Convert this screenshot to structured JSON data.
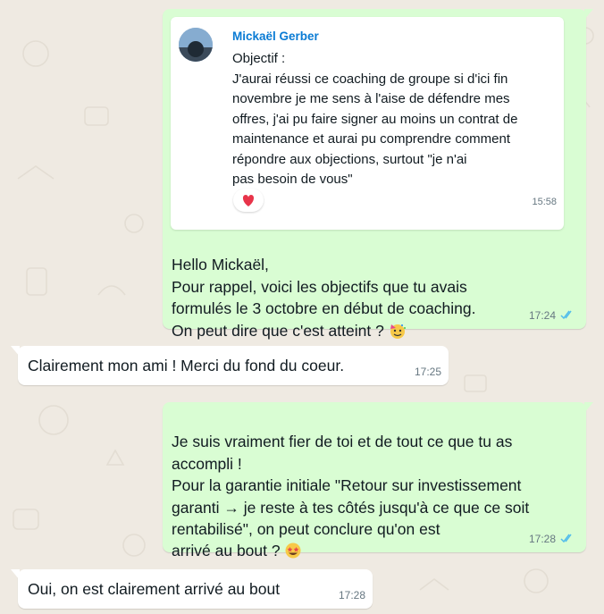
{
  "colors": {
    "background": "#efeae2",
    "outgoing_bubble": "#d9fdd3",
    "incoming_bubble": "#ffffff",
    "quoted_author": "#0a7bd4",
    "read_ticks": "#53bdeb",
    "heart": "#e8344a"
  },
  "messages": [
    {
      "direction": "outgoing",
      "quoted": {
        "author": "Mickaël Gerber",
        "text": "Objectif :\nJ'aurai réussi ce coaching de groupe si d'ici fin\nnovembre je me sens à l'aise de défendre mes\noffres, j'ai pu faire signer au moins un contrat de\nmaintenance et aurai pu comprendre comment\nrépondre aux objections, surtout \"je n'ai\npas besoin de vous\"",
        "time": "15:58",
        "reaction": "heart-emoji"
      },
      "text": "Hello Mickaël,\nPour rappel, voici les objectifs que tu avais\nformulés le 3 octobre en début de coaching.\nOn peut dire que c'est atteint ?",
      "emoji": "partying-face-emoji",
      "time": "17:24",
      "status": "read"
    },
    {
      "direction": "incoming",
      "text": "Clairement mon ami ! Merci du fond du coeur.",
      "time": "17:25"
    },
    {
      "direction": "outgoing",
      "text": "Je suis vraiment fier de toi et de tout ce que tu as\naccompli !\nPour la garantie initiale \"Retour sur investissement\ngaranti → je reste à tes côtés jusqu'à ce que ce soit\nrentabilisé\", on peut conclure qu'on est\narrivé au bout ?",
      "emoji": "star-struck-emoji",
      "time": "17:28",
      "status": "read"
    },
    {
      "direction": "incoming",
      "text": "Oui, on est clairement arrivé au bout",
      "time": "17:28"
    }
  ]
}
